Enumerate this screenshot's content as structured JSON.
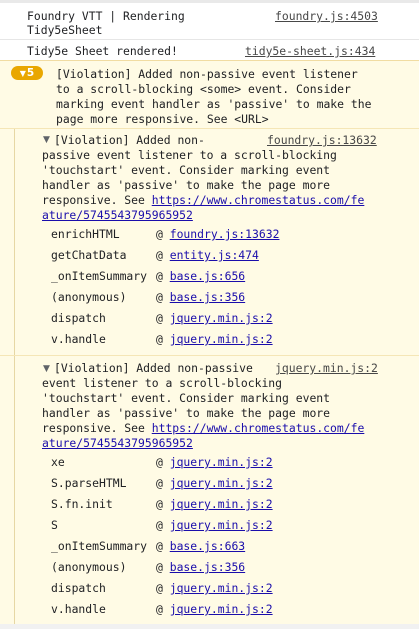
{
  "log1": {
    "text_line1": "Foundry VTT | Rendering",
    "text_line2": "Tidy5eSheet",
    "source": "foundry.js:4503"
  },
  "log2": {
    "text": "Tidy5e Sheet rendered!",
    "source": "tidy5e-sheet.js:434"
  },
  "violation_main": {
    "count": "5",
    "lines": [
      "[Violation] Added non-passive event listener",
      "to a scroll-blocking <some> event. Consider",
      "marking event handler as 'passive' to make the",
      "page more responsive. See <URL>"
    ]
  },
  "group1": {
    "first_line": "[Violation] Added non-",
    "source": "foundry.js:13632",
    "lines": [
      "passive event listener to a scroll-blocking",
      "'touchstart' event. Consider marking event",
      "handler as 'passive' to make the page more",
      "responsive. See "
    ],
    "url_part1": "https://www.chromestatus.com/fe",
    "url_part2": "ature/5745543795965952",
    "stack": [
      {
        "fn": "enrichHTML",
        "loc": "foundry.js:13632"
      },
      {
        "fn": "getChatData",
        "loc": "entity.js:474"
      },
      {
        "fn": "_onItemSummary",
        "loc": "base.js:656"
      },
      {
        "fn": "(anonymous)",
        "loc": "base.js:356"
      },
      {
        "fn": "dispatch",
        "loc": "jquery.min.js:2"
      },
      {
        "fn": "v.handle",
        "loc": "jquery.min.js:2"
      }
    ]
  },
  "group2": {
    "first_line": "[Violation] Added non-passive",
    "source": "jquery.min.js:2",
    "lines": [
      "event listener to a scroll-blocking",
      "'touchstart' event. Consider marking event",
      "handler as 'passive' to make the page more",
      "responsive. See "
    ],
    "url_part1": "https://www.chromestatus.com/fe",
    "url_part2": "ature/5745543795965952",
    "stack": [
      {
        "fn": "xe",
        "loc": "jquery.min.js:2"
      },
      {
        "fn": "S.parseHTML",
        "loc": "jquery.min.js:2"
      },
      {
        "fn": "S.fn.init",
        "loc": "jquery.min.js:2"
      },
      {
        "fn": "S",
        "loc": "jquery.min.js:2"
      },
      {
        "fn": "_onItemSummary",
        "loc": "base.js:663"
      },
      {
        "fn": "(anonymous)",
        "loc": "base.js:356"
      },
      {
        "fn": "dispatch",
        "loc": "jquery.min.js:2"
      },
      {
        "fn": "v.handle",
        "loc": "jquery.min.js:2"
      }
    ],
    "at_symbol": "@"
  }
}
